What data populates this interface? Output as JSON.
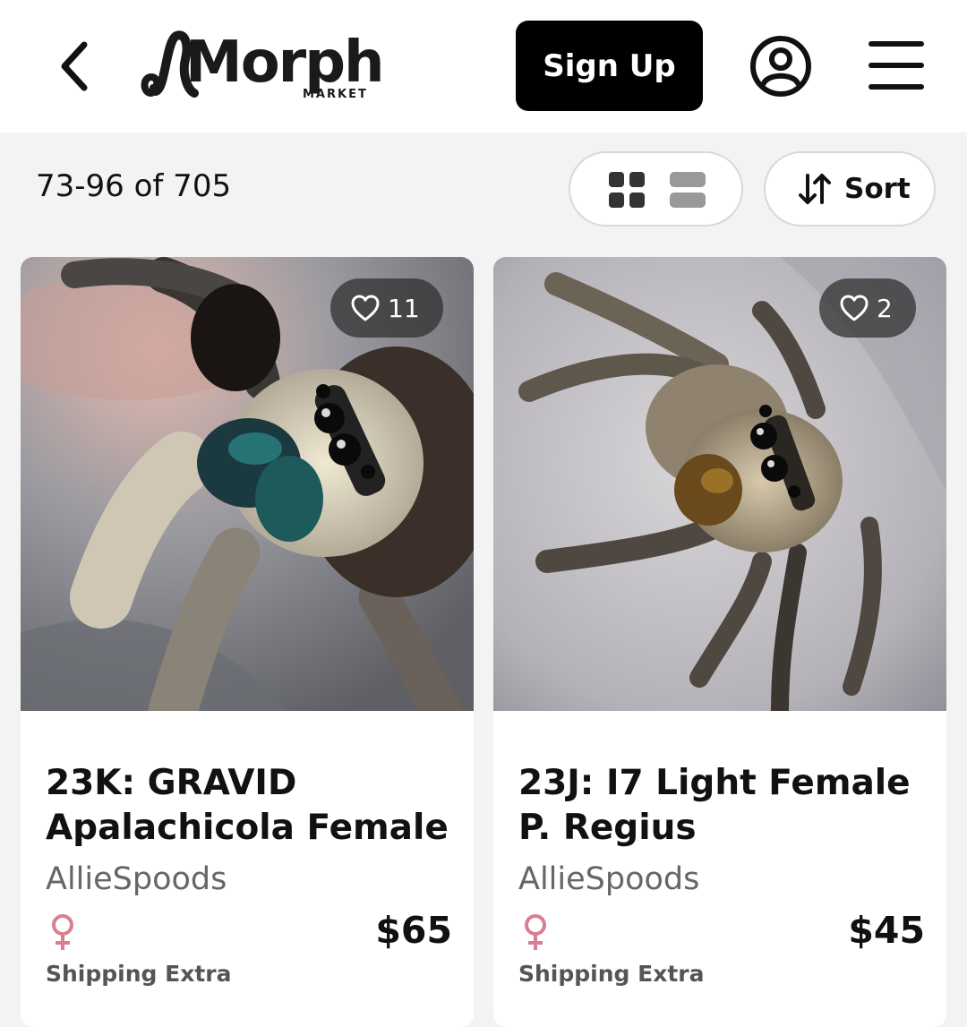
{
  "header": {
    "logo_text": "Morph",
    "logo_subtext": "MARKET",
    "signup_label": "Sign Up",
    "icons": [
      "chevron-left-icon",
      "account-icon",
      "hamburger-menu-icon"
    ]
  },
  "toolbar": {
    "result_count": "73-96 of 705",
    "view_modes": [
      "grid",
      "list"
    ],
    "active_view": "grid",
    "sort_label": "Sort"
  },
  "listings": [
    {
      "favorites": "11",
      "title": "23K: GRAVID Apalachicola Female",
      "seller": "AllieSpoods",
      "sex": "female",
      "price": "$65",
      "shipping": "Shipping Extra"
    },
    {
      "favorites": "2",
      "title": "23J: I7 Light Female P. Regius",
      "seller": "AllieSpoods",
      "sex": "female",
      "price": "$45",
      "shipping": "Shipping Extra"
    }
  ],
  "colors": {
    "background": "#f3f3f3",
    "header_bg": "#ffffff",
    "primary_button": "#000000",
    "female_symbol": "#d97f92",
    "seller_text": "#666666"
  }
}
